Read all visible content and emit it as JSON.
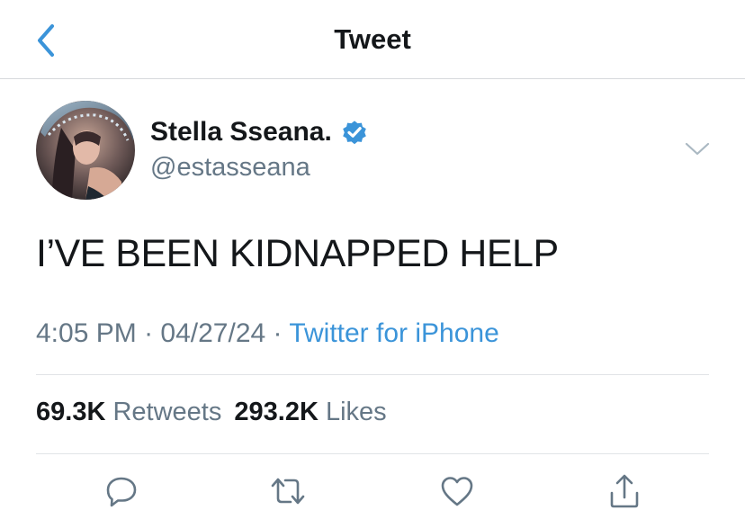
{
  "header": {
    "title": "Tweet",
    "back_icon": "chevron-left-icon"
  },
  "author": {
    "display_name": "Stella Sseana.",
    "handle": "@estasseana",
    "verified": true,
    "avatar_icon": "profile-photo"
  },
  "tweet": {
    "text": "I’VE BEEN KIDNAPPED HELP",
    "time": "4:05 PM",
    "date": "04/27/24",
    "separator": " · ",
    "source": "Twitter for iPhone"
  },
  "stats": {
    "retweets_count": "69.3K",
    "retweets_label": "Retweets",
    "likes_count": "293.2K",
    "likes_label": "Likes"
  },
  "actions": [
    "reply-icon",
    "retweet-icon",
    "like-icon",
    "share-icon"
  ],
  "colors": {
    "text": "#14171a",
    "secondary": "#657786",
    "accent": "#3b94d9",
    "verified_badge": "#3b94d9",
    "divider": "#e1e4e7"
  }
}
